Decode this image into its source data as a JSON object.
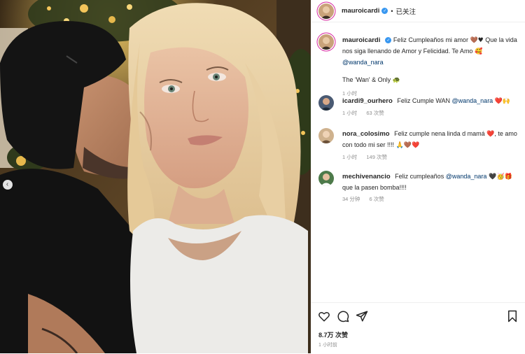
{
  "post": {
    "username": "mauroicardi",
    "follow_status": "已关注",
    "caption_prefix": "Feliz Cumpleaños mi amor ",
    "caption_emoji": "🤎♥",
    "caption_mid": " Que la vida nos siga llenando de Amor y Felicidad. Te Amo ",
    "caption_emoji2": "🥰",
    "caption_mention": "@wanda_nara",
    "caption_line2": "The 'Wan' & Only ",
    "caption_line2_emoji": "🐢",
    "caption_time": "1 小时"
  },
  "comments": [
    {
      "username": "icardi9_ourhero",
      "text": "Feliz Cumple WAN ",
      "mention": "@wanda_nara",
      "emoji": "❤️🙌",
      "time": "1 小时",
      "likes": "63 次赞"
    },
    {
      "username": "nora_colosimo",
      "text": "Feliz cumple nena linda d mamá ",
      "emoji": "❤️",
      "text2": ", te amo con todo mi ser !!!! ",
      "emoji2": "🙏🤎❤️",
      "time": "1 小时",
      "likes": "149 次赞"
    },
    {
      "username": "mechivenancio",
      "text": "Feliz cumpleaños ",
      "mention": "@wanda_nara",
      "emoji": " 🖤🥳🎁",
      "text2": " que la pasen bomba!!!!",
      "time": "34 分钟",
      "likes": "6 次赞"
    }
  ],
  "footer": {
    "likes_count": "8.7万 次赞",
    "posted_time": "1 小时前"
  },
  "icons": [
    "heart-icon",
    "comment-icon",
    "share-icon",
    "bookmark-icon",
    "verified-badge-icon",
    "carousel-prev-icon"
  ],
  "colors": {
    "accent_link": "#00376b",
    "verified_blue": "#3897f0",
    "heart_red": "#ed4956",
    "muted_text": "#8e8e8e"
  }
}
